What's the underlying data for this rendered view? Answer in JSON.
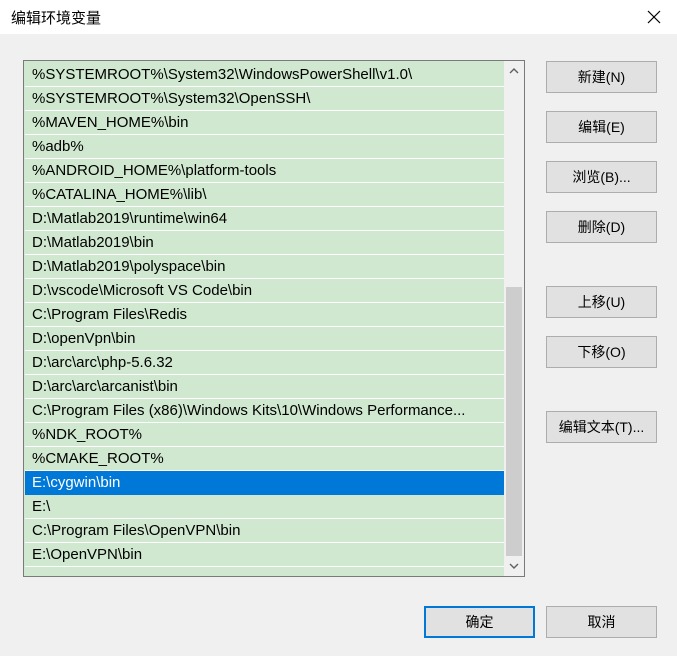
{
  "dialog": {
    "title": "编辑环境变量",
    "close_icon": "close-icon"
  },
  "path_list": {
    "items": [
      "%SYSTEMROOT%\\System32\\WindowsPowerShell\\v1.0\\",
      "%SYSTEMROOT%\\System32\\OpenSSH\\",
      "%MAVEN_HOME%\\bin",
      "%adb%",
      "%ANDROID_HOME%\\platform-tools",
      "%CATALINA_HOME%\\lib\\",
      "D:\\Matlab2019\\runtime\\win64",
      "D:\\Matlab2019\\bin",
      "D:\\Matlab2019\\polyspace\\bin",
      "D:\\vscode\\Microsoft VS Code\\bin",
      "C:\\Program Files\\Redis",
      "D:\\openVpn\\bin",
      "D:\\arc\\arc\\php-5.6.32",
      "D:\\arc\\arc\\arcanist\\bin",
      "C:\\Program Files (x86)\\Windows Kits\\10\\Windows Performance...",
      "%NDK_ROOT%",
      "%CMAKE_ROOT%",
      "E:\\cygwin\\bin",
      "E:\\",
      "C:\\Program Files\\OpenVPN\\bin",
      "E:\\OpenVPN\\bin"
    ],
    "selected_index": 17,
    "colors": {
      "row_background": "#cfe8cf",
      "selected_background": "#0078d7"
    }
  },
  "buttons": {
    "new": "新建(N)",
    "edit": "编辑(E)",
    "browse": "浏览(B)...",
    "delete": "删除(D)",
    "move_up": "上移(U)",
    "move_down": "下移(O)",
    "edit_text": "编辑文本(T)...",
    "ok": "确定",
    "cancel": "取消"
  }
}
